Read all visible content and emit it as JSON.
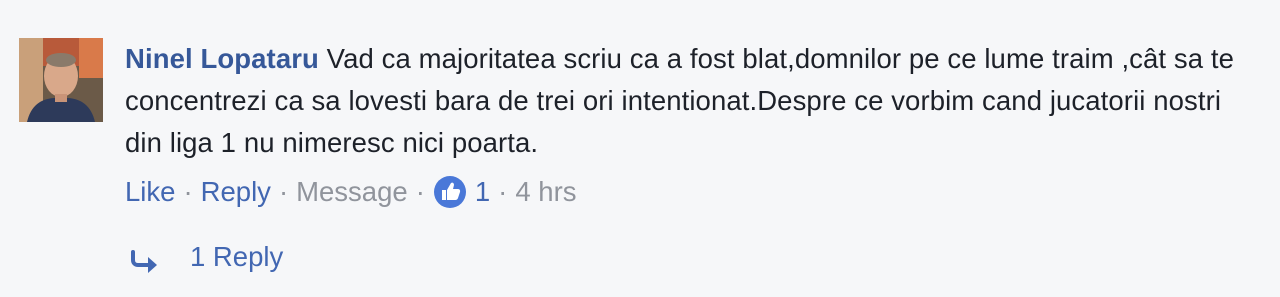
{
  "comment": {
    "author": "Ninel Lopataru",
    "text": "Vad ca majoritatea scriu ca a fost blat,domnilor pe ce lume traim ,cât sa te concentrezi ca sa lovesti bara de trei ori intentionat.Despre ce vorbim cand jucatorii nostri din liga 1 nu nimeresc nici poarta.",
    "actions": {
      "like_label": "Like",
      "reply_label": "Reply",
      "message_label": "Message",
      "separator": "·",
      "like_count": "1",
      "timestamp": "4 hrs"
    },
    "replies_label": "1 Reply"
  },
  "icons": {
    "like_badge": "thumbs-up-icon",
    "reply_arrow": "reply-arrow-icon"
  },
  "colors": {
    "author": "#365899",
    "link": "#4267b2",
    "muted": "#90949c",
    "text": "#1d2129",
    "background": "#f6f7f9"
  }
}
